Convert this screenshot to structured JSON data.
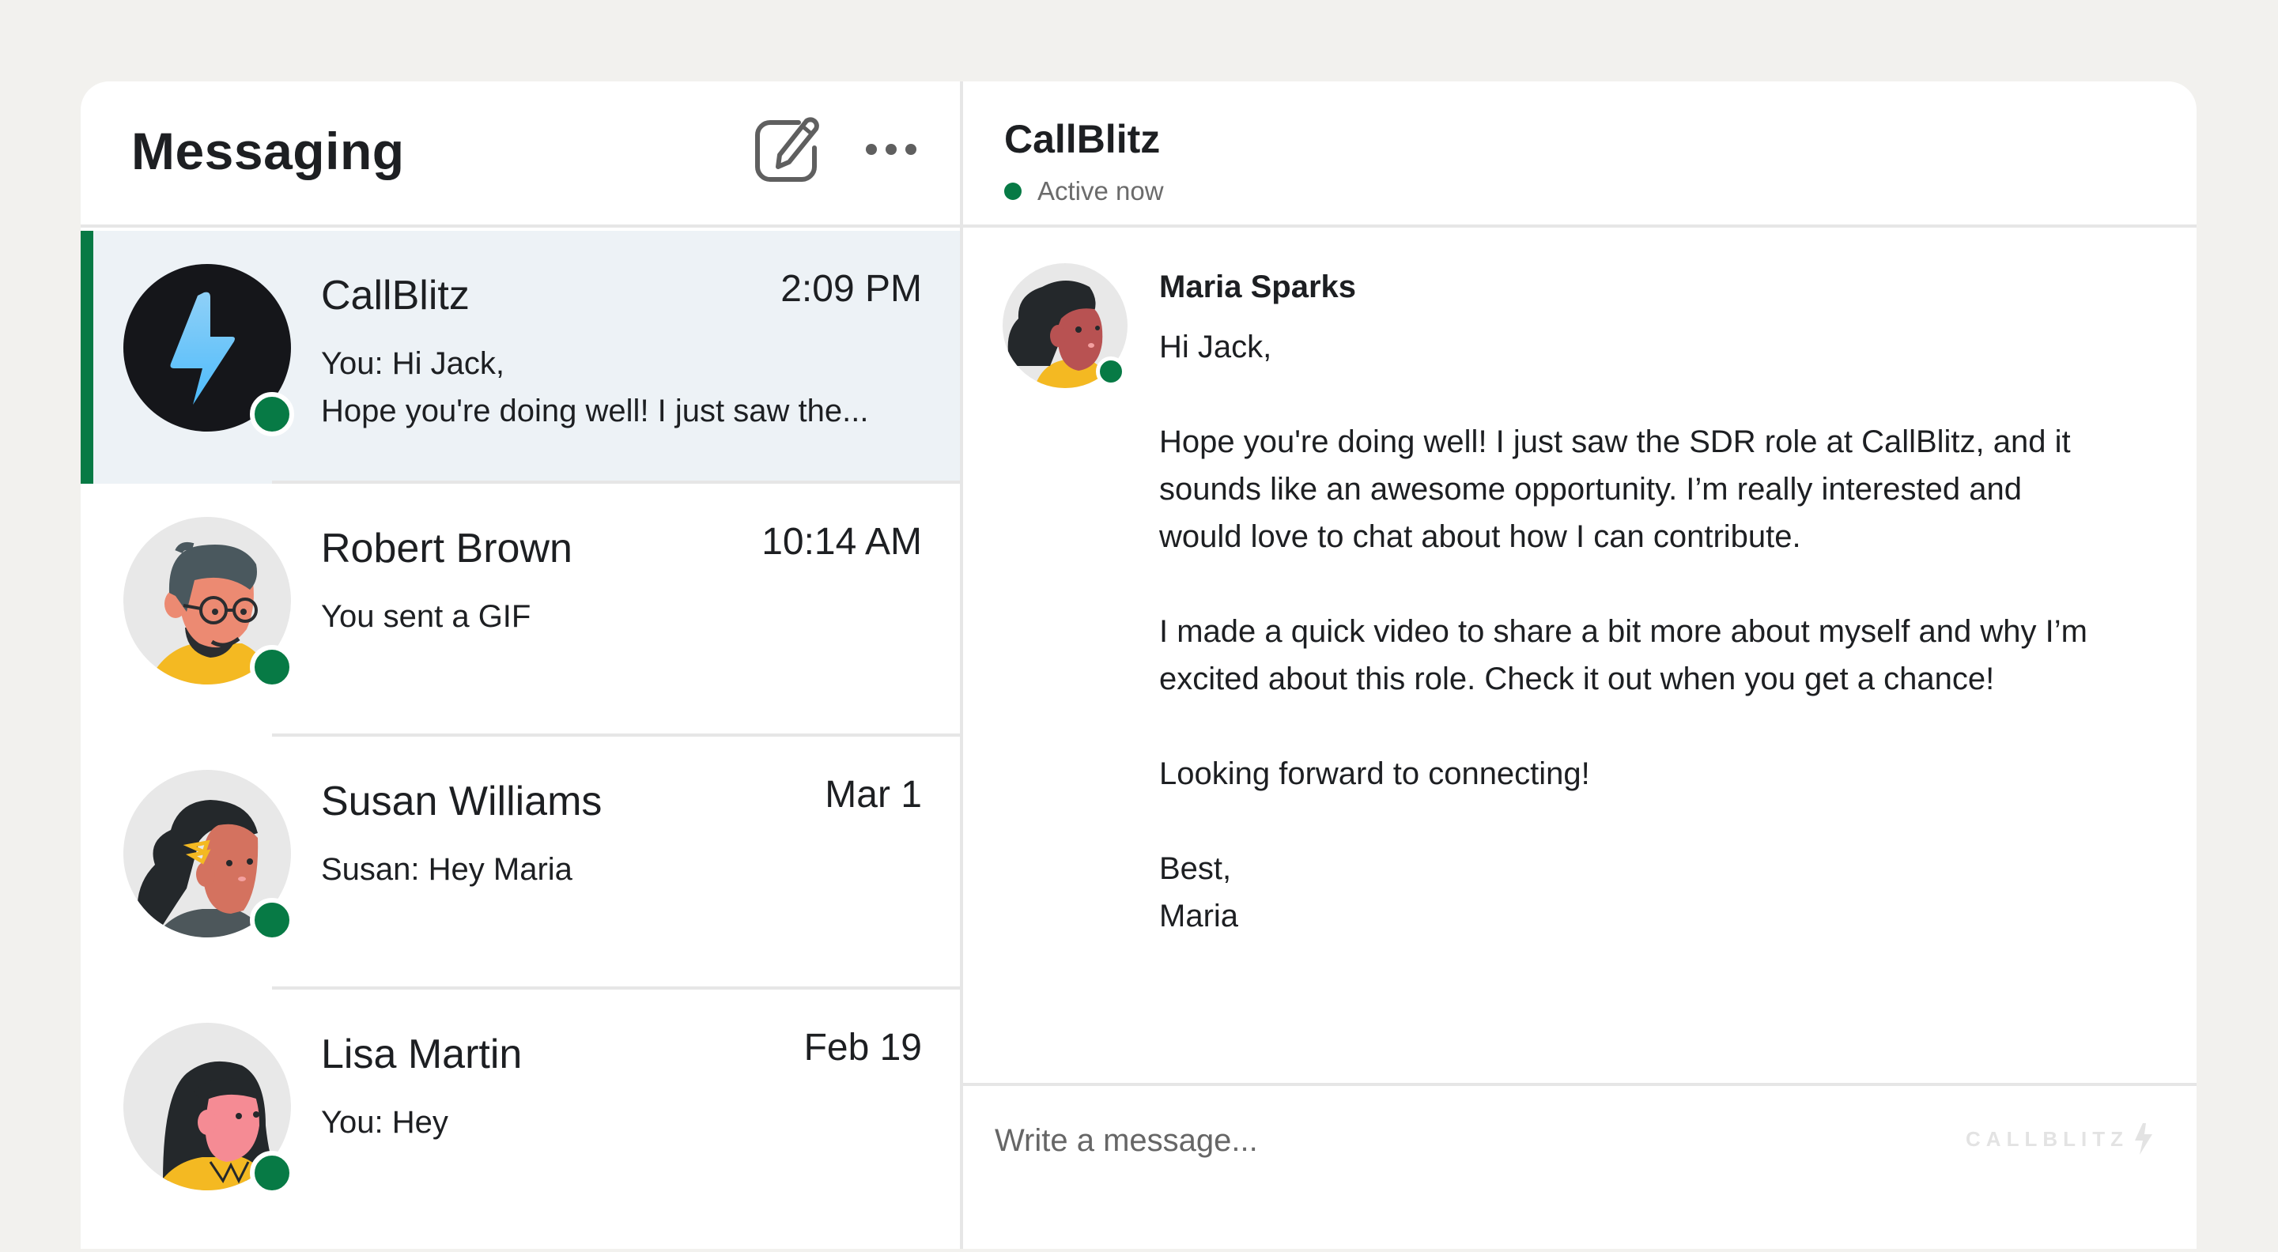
{
  "sidebar": {
    "title": "Messaging",
    "compose_icon": "compose-icon",
    "more_icon": "more-horizontal-icon",
    "conversations": [
      {
        "name": "CallBlitz",
        "time": "2:09 PM",
        "preview_lines": [
          "You: Hi Jack,",
          "Hope you're doing well! I just saw the..."
        ],
        "avatar": "callblitz-logo",
        "online": true,
        "selected": true
      },
      {
        "name": "Robert Brown",
        "time": "10:14 AM",
        "preview_lines": [
          "You sent a GIF"
        ],
        "avatar": "robert-brown-illustration",
        "online": true,
        "selected": false
      },
      {
        "name": "Susan Williams",
        "time": "Mar 1",
        "preview_lines": [
          "Susan: Hey Maria"
        ],
        "avatar": "susan-williams-illustration",
        "online": true,
        "selected": false
      },
      {
        "name": "Lisa Martin",
        "time": "Feb 19",
        "preview_lines": [
          "You: Hey"
        ],
        "avatar": "lisa-martin-illustration",
        "online": true,
        "selected": false
      }
    ]
  },
  "chat": {
    "title": "CallBlitz",
    "status": "Active now",
    "message": {
      "sender": "Maria Sparks",
      "paragraphs": [
        "Hi Jack,",
        "Hope you're doing well! I just saw the SDR role at CallBlitz, and it sounds like an awesome opportunity. I’m really interested and would love to chat about how I can contribute.",
        "I made a quick video to share a bit more about myself and why I’m excited about this role. Check it out when you get a chance!",
        "Looking forward to connecting!",
        "Best,",
        "Maria"
      ]
    },
    "composer": {
      "placeholder": "Write a message...",
      "value": ""
    },
    "brand_watermark": "CALLBLITZ"
  },
  "colors": {
    "accent_green": "#077a45",
    "selected_row_bg": "#edf2f6",
    "page_bg": "#f2f1ee",
    "lightning_blue": "#5fc3fb"
  }
}
